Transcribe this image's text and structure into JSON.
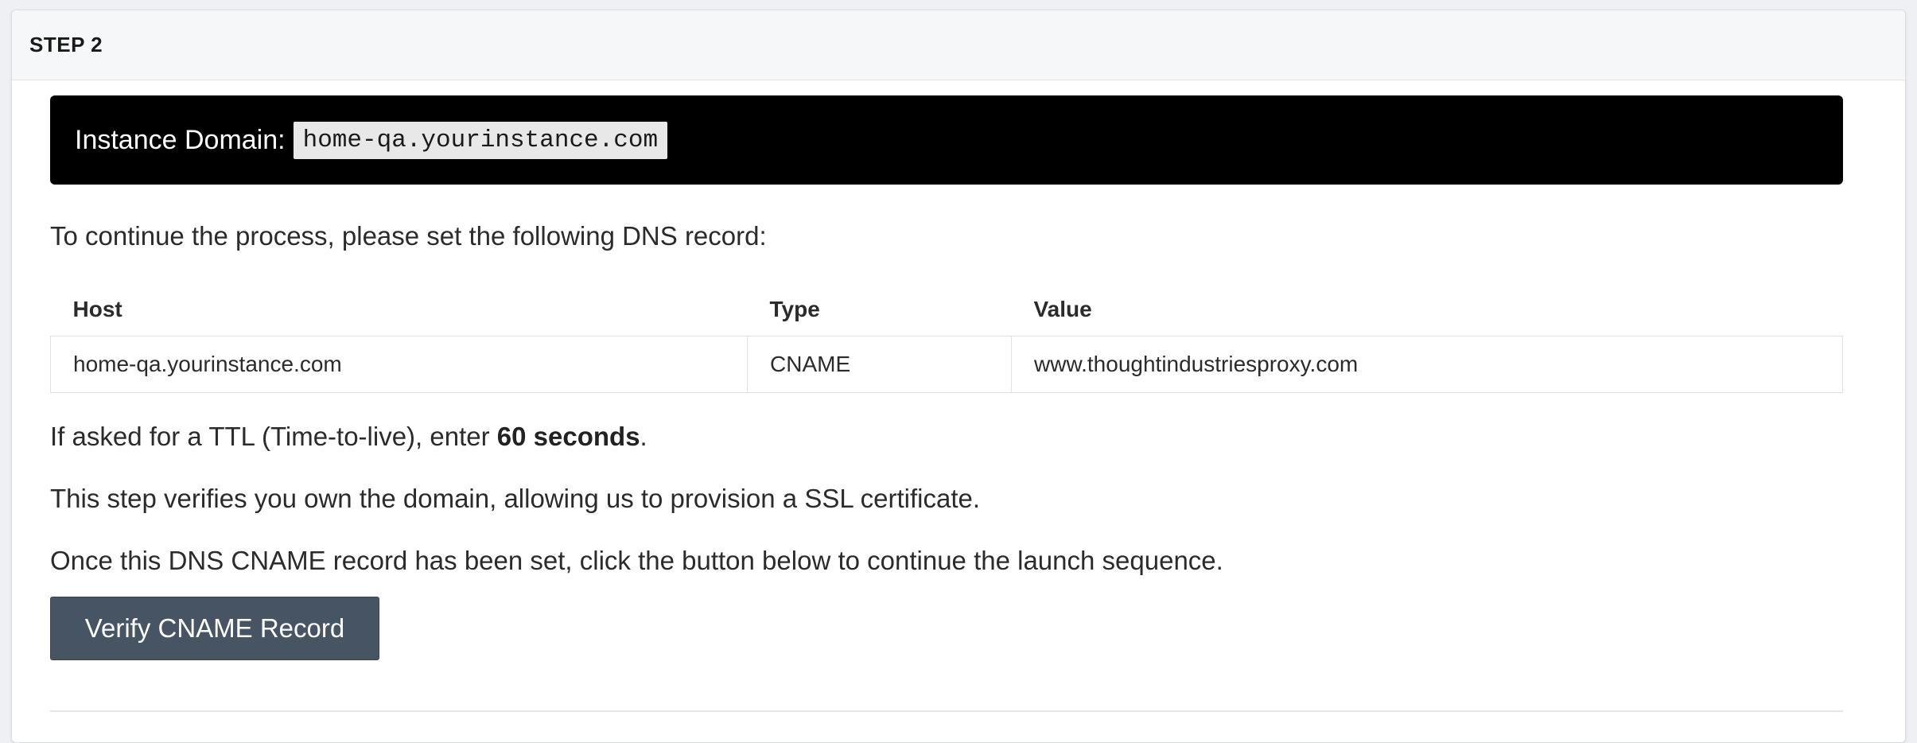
{
  "step": {
    "title": "STEP 2"
  },
  "banner": {
    "label": "Instance Domain:",
    "domain": "home-qa.yourinstance.com"
  },
  "intro": "To continue the process, please set the following DNS record:",
  "table": {
    "headers": [
      "Host",
      "Type",
      "Value"
    ],
    "rows": [
      [
        "home-qa.yourinstance.com",
        "CNAME",
        "www.thoughtindustriesproxy.com"
      ]
    ]
  },
  "ttl": {
    "prefix": "If asked for a TTL (Time-to-live), enter ",
    "value": "60 seconds",
    "suffix": "."
  },
  "verify_note": "This step verifies you own the domain, allowing us to provision a SSL certificate.",
  "continue_note": "Once this DNS CNAME record has been set, click the button below to continue the launch sequence.",
  "button": {
    "label": "Verify CNAME Record"
  },
  "colors": {
    "banner_bg": "#000000",
    "button_bg": "#465464"
  }
}
